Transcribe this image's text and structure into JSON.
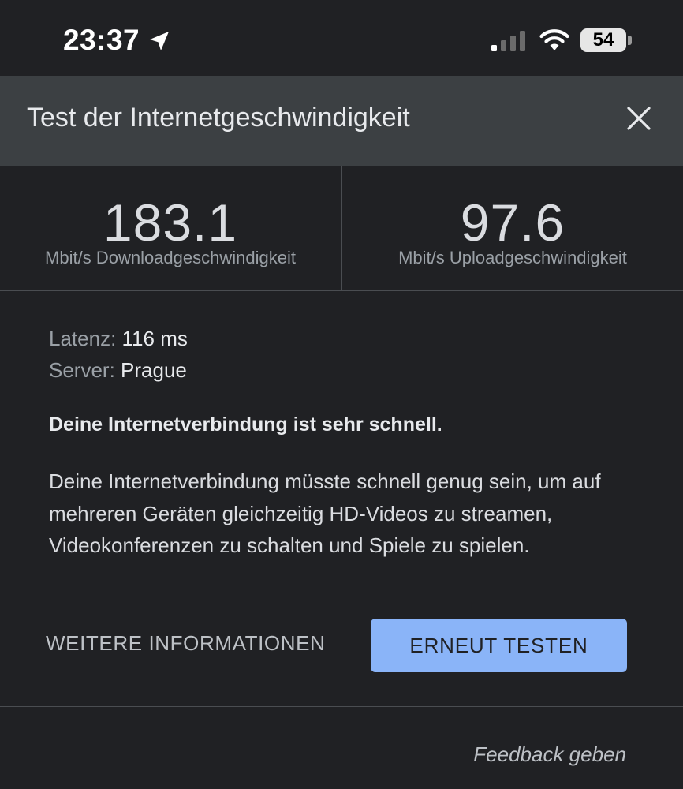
{
  "status_bar": {
    "time": "23:37",
    "battery": "54",
    "icons": [
      "location-arrow-icon",
      "cell-signal-icon",
      "wifi-icon",
      "battery-icon"
    ]
  },
  "header": {
    "title": "Test der Internetgeschwindigkeit",
    "close_icon": "close-icon"
  },
  "metrics": {
    "download": {
      "value": "183.1",
      "label": "Mbit/s Downloadgeschwindigkeit"
    },
    "upload": {
      "value": "97.6",
      "label": "Mbit/s Uploadgeschwindigkeit"
    }
  },
  "details": {
    "latency_label": "Latenz:",
    "latency_value": "116 ms",
    "server_label": "Server:",
    "server_value": "Prague"
  },
  "summary": "Deine Internetverbindung ist sehr schnell.",
  "description": "Deine Internetverbindung müsste schnell genug sein, um auf mehreren Geräten gleichzeitig HD-Videos zu streamen, Videokonferenzen zu schalten und Spiele zu spielen.",
  "actions": {
    "more_info": "WEITERE INFORMATIONEN",
    "retest": "ERNEUT TESTEN"
  },
  "feedback": "Feedback geben",
  "colors": {
    "background": "#202124",
    "header": "#3c4043",
    "accent": "#8ab4f8"
  }
}
